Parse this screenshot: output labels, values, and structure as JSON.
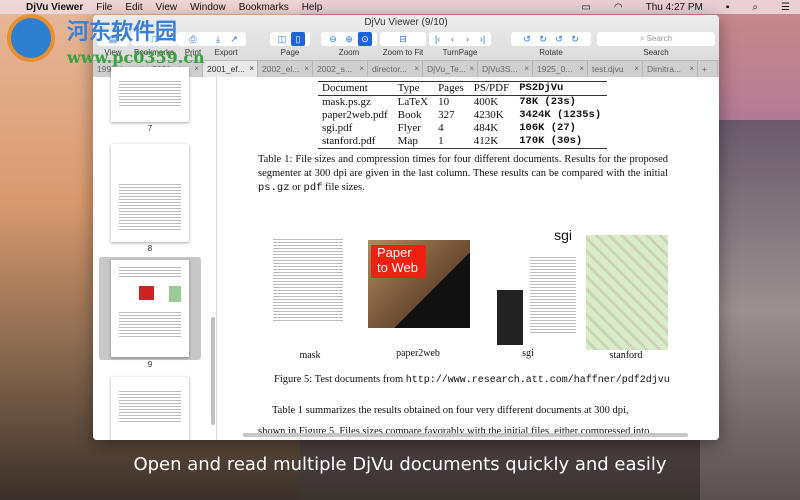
{
  "menubar": {
    "app": "DjVu Viewer",
    "items": [
      "File",
      "Edit",
      "View",
      "Window",
      "Bookmarks",
      "Help"
    ],
    "clock": "Thu 4:27 PM"
  },
  "window": {
    "title": "DjVu Viewer (9/10)"
  },
  "toolbar": {
    "view": "View",
    "bookmarks": "Bookmarks",
    "print": "Print",
    "export": "Export",
    "page": "Page",
    "zoom": "Zoom",
    "zoom_fit": "Zoom to Fit",
    "turnpage": "TurnPage",
    "rotate": "Rotate",
    "search": "Search",
    "search_placeholder": "Search"
  },
  "tabs": [
    "1998_br...",
    "2001_d...",
    "2001_ef...",
    "2002_el...",
    "2002_s...",
    "director...",
    "DjVu_Te...",
    "DjVu3S...",
    "1925_0...",
    "test.djvu",
    "Dimitra..."
  ],
  "active_tab": 2,
  "thumbnails": {
    "pages": [
      "7",
      "8",
      "9"
    ],
    "selected": "9"
  },
  "document": {
    "table": {
      "headers": [
        "Document",
        "Type",
        "Pages",
        "PS/PDF",
        "PS2DjVu"
      ],
      "rows": [
        [
          "mask.ps.gz",
          "LaTeX",
          "10",
          "400K",
          "78K (23s)"
        ],
        [
          "paper2web.pdf",
          "Book",
          "327",
          "4230K",
          "3424K (1235s)"
        ],
        [
          "sgi.pdf",
          "Flyer",
          "4",
          "484K",
          "106K (27)"
        ],
        [
          "stanford.pdf",
          "Map",
          "1",
          "412K",
          "170K (30s)"
        ]
      ]
    },
    "table_caption_a": "Table 1: File sizes and compression times for four different documents. Results for the proposed segmenter at 300 dpi are given in the last column. These results can be compared with the initial ",
    "table_caption_ps": "ps.gz",
    "table_caption_or": " or ",
    "table_caption_pdf": "pdf",
    "table_caption_b": " file sizes.",
    "figure_labels": [
      "mask",
      "paper2web",
      "sgi",
      "stanford"
    ],
    "paper_title_a": "Paper",
    "paper_title_b": "to Web",
    "sgi_logo": "sgi",
    "figure_caption": "Figure 5: Test documents from ",
    "figure_url": "http://www.research.att.com/haffner/pdf2djvu",
    "body_1": "Table 1 summarizes the results obtained on four very different documents at 300 dpi,",
    "body_2": "shown in Figure 5. Files sizes compare favorably with the initial files, either compressed into"
  },
  "promo_caption": "Open and read multiple DjVu documents quickly and easily",
  "watermark": {
    "name": "河东软件园",
    "url": "www.pc0359.cn"
  }
}
